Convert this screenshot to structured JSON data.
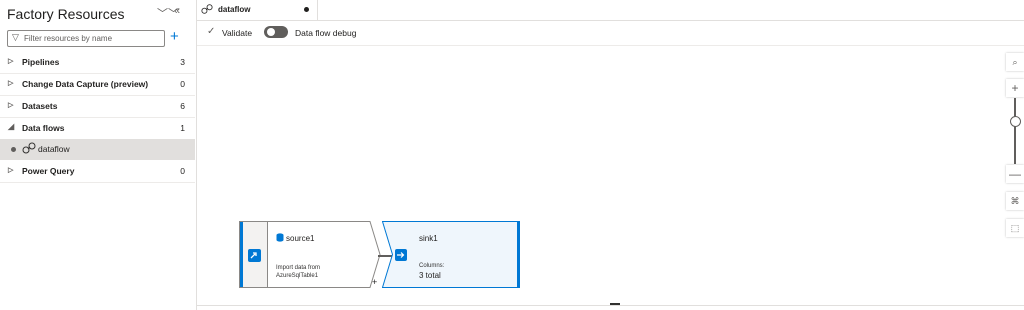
{
  "sidebar": {
    "title": "Factory Resources",
    "collapse_all_icon": "double-chevron-down-icon",
    "collapse_panel_icon": "double-chevron-left-icon",
    "filter_placeholder": "Filter resources by name",
    "filter_value": "",
    "add_icon": "plus-icon",
    "items": [
      {
        "label": "Pipelines",
        "count": "3",
        "expanded": false
      },
      {
        "label": "Change Data Capture (preview)",
        "count": "0",
        "expanded": false
      },
      {
        "label": "Datasets",
        "count": "6",
        "expanded": false
      },
      {
        "label": "Data flows",
        "count": "1",
        "expanded": true,
        "children": [
          {
            "label": "dataflow"
          }
        ]
      },
      {
        "label": "Power Query",
        "count": "0",
        "expanded": false
      }
    ]
  },
  "tab": {
    "label": "dataflow",
    "unsaved": true
  },
  "toolbar": {
    "validate_label": "Validate",
    "debug_label": "Data flow debug",
    "debug_on": false
  },
  "canvas": {
    "source": {
      "title": "source1",
      "subtitle_line1": "Import data from",
      "subtitle_line2": "AzureSqlTable1",
      "add_symbol": "+"
    },
    "sink": {
      "title": "sink1",
      "columns_label": "Columns:",
      "columns_value": "3 total"
    },
    "zoom_controls": [
      "search-icon",
      "zoom-in-icon",
      "zoom-slider",
      "zoom-out-icon",
      "fit-to-screen-icon",
      "select-icon"
    ],
    "accent_color": "#0078d4"
  }
}
